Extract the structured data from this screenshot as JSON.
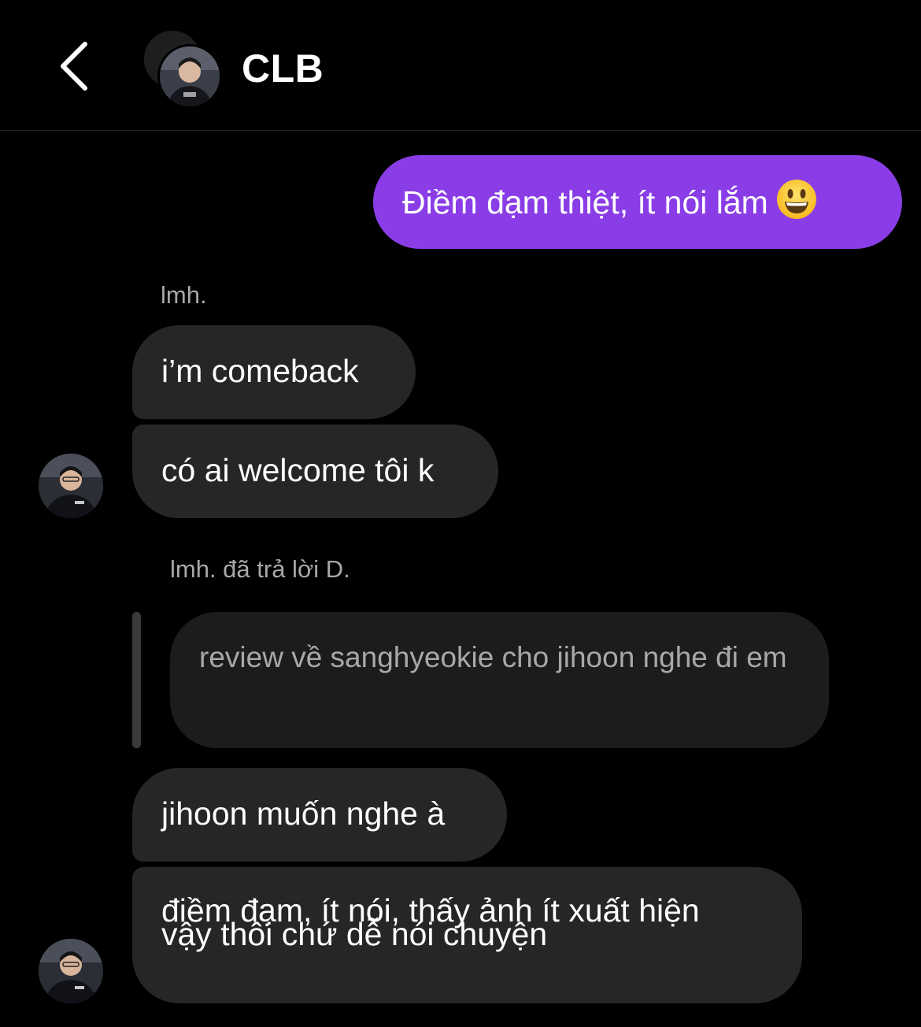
{
  "header": {
    "back_icon": "chevron-left-icon",
    "title": "CLB"
  },
  "messages": {
    "sent_1": {
      "text": "Điềm đạm thiệt, ít nói lắm",
      "emoji_icon": "grinning-face-emoji"
    },
    "sender_1": "lmh.",
    "recv_1": "i’m comeback",
    "recv_2": "có ai welcome tôi k",
    "reply_meta": "lmh. đã trả lời D.",
    "quoted": "review về sanghyeokie cho jihoon nghe đi em",
    "recv_3": "jihoon muốn nghe à",
    "recv_4_line1": "điềm đạm, ít nói, thấy ảnh ít xuất hiện",
    "recv_4_line2": "vậy thôi chứ dễ nói chuyện"
  },
  "colors": {
    "background": "#000000",
    "sent_bubble": "#8a3de6",
    "received_bubble": "#262626",
    "quoted_bubble": "#1c1c1c",
    "muted_text": "#a8a8a8"
  }
}
